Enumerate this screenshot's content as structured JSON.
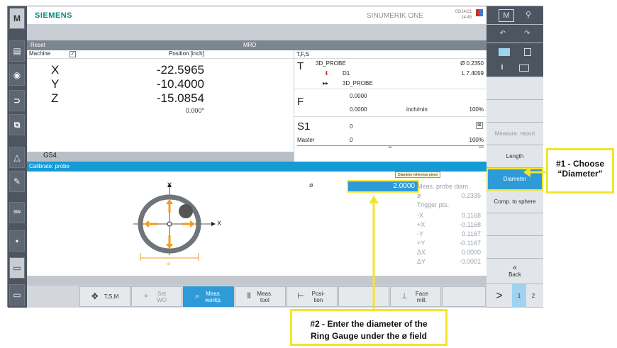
{
  "header": {
    "brand": "SIEMENS",
    "product": "SINUMERIK ONE",
    "date": "05/14/21",
    "time": "14:45"
  },
  "channel": {
    "status": "Reset",
    "mode": "MRD"
  },
  "position": {
    "col_machine": "Machine",
    "col_position": "Position [inch]",
    "axes": [
      {
        "name": "X",
        "value": "-22.5965"
      },
      {
        "name": "Y",
        "value": "-10.4000"
      },
      {
        "name": "Z",
        "value": "-15.0854"
      }
    ],
    "angle": "0.000°",
    "wcs": "G54"
  },
  "tfs": {
    "header": "T,F,S",
    "t_label": "T",
    "tool": "3D_PROBE",
    "diameter": "Ø 0.2350",
    "d_label": "D1",
    "length": "L 7.4059",
    "next_tool": "3D_PROBE",
    "f_label": "F",
    "f_actual": "0.0000",
    "f_set": "0.0000",
    "f_unit": "inch/min",
    "f_override": "100%",
    "s_label": "S1",
    "s_value": "0",
    "master_label": "Master",
    "master_value": "0",
    "master_override": "100%",
    "scale_50": "50",
    "scale_100": "100"
  },
  "calibrate": {
    "title": "Calibrate: probe",
    "y_axis": "Y",
    "x_axis": "X",
    "dim_label": "ø",
    "field_symbol": "ø",
    "field_value": "2.0000",
    "field_tooltip": "Diameter reference piece",
    "results": [
      {
        "label": "Meas. probe diam.",
        "value": ""
      },
      {
        "label": "ø",
        "value": "0.2335"
      },
      {
        "label": "Trigger pts.",
        "value": ""
      },
      {
        "label": "-X",
        "value": "0.1168"
      },
      {
        "label": "+X",
        "value": "-0.1168"
      },
      {
        "label": "-Y",
        "value": "0.1167"
      },
      {
        "label": "+Y",
        "value": "-0.1167"
      },
      {
        "label": "ΔX",
        "value": "0.0000"
      },
      {
        "label": "ΔY",
        "value": "-0.0001"
      }
    ]
  },
  "hsoftkeys": [
    {
      "label": "T,S,M",
      "icon": "tsm-icon"
    },
    {
      "label": "Set WO",
      "icon": "set-wo-icon"
    },
    {
      "label": "Meas. workp.",
      "icon": "meas-workpiece-icon"
    },
    {
      "label": "Meas. tool",
      "icon": "meas-tool-icon"
    },
    {
      "label": "Posi- tion",
      "icon": "position-icon"
    },
    {
      "label": "Face mill.",
      "icon": "face-mill-icon"
    }
  ],
  "vsoftkeys": {
    "measure_report": "Measure. report",
    "length": "Length",
    "diameter": "Diameter",
    "comp_sphere": "Comp. to sphere",
    "back_symbol": "«",
    "back": "Back",
    "next": ">",
    "page1": "1",
    "page2": "2"
  },
  "annotations": {
    "a1": "#1 - Choose “Diameter”",
    "a2_line1": "#2 - Enter the diameter of the",
    "a2_line2": "Ring Gauge under the ø field"
  },
  "colors": {
    "accent_blue": "#2e9bd8",
    "annotation_yellow": "#f4e42a",
    "brand_teal": "#0b8a86"
  }
}
